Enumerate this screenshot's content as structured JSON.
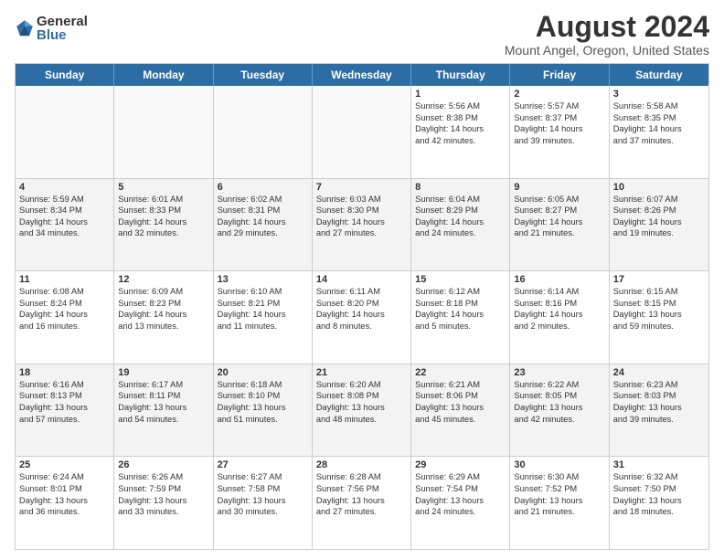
{
  "logo": {
    "general": "General",
    "blue": "Blue"
  },
  "title": "August 2024",
  "subtitle": "Mount Angel, Oregon, United States",
  "days": [
    "Sunday",
    "Monday",
    "Tuesday",
    "Wednesday",
    "Thursday",
    "Friday",
    "Saturday"
  ],
  "weeks": [
    [
      {
        "day": "",
        "lines": [],
        "empty": true
      },
      {
        "day": "",
        "lines": [],
        "empty": true
      },
      {
        "day": "",
        "lines": [],
        "empty": true
      },
      {
        "day": "",
        "lines": [],
        "empty": true
      },
      {
        "day": "1",
        "lines": [
          "Sunrise: 5:56 AM",
          "Sunset: 8:38 PM",
          "Daylight: 14 hours",
          "and 42 minutes."
        ]
      },
      {
        "day": "2",
        "lines": [
          "Sunrise: 5:57 AM",
          "Sunset: 8:37 PM",
          "Daylight: 14 hours",
          "and 39 minutes."
        ]
      },
      {
        "day": "3",
        "lines": [
          "Sunrise: 5:58 AM",
          "Sunset: 8:35 PM",
          "Daylight: 14 hours",
          "and 37 minutes."
        ]
      }
    ],
    [
      {
        "day": "4",
        "lines": [
          "Sunrise: 5:59 AM",
          "Sunset: 8:34 PM",
          "Daylight: 14 hours",
          "and 34 minutes."
        ]
      },
      {
        "day": "5",
        "lines": [
          "Sunrise: 6:01 AM",
          "Sunset: 8:33 PM",
          "Daylight: 14 hours",
          "and 32 minutes."
        ]
      },
      {
        "day": "6",
        "lines": [
          "Sunrise: 6:02 AM",
          "Sunset: 8:31 PM",
          "Daylight: 14 hours",
          "and 29 minutes."
        ]
      },
      {
        "day": "7",
        "lines": [
          "Sunrise: 6:03 AM",
          "Sunset: 8:30 PM",
          "Daylight: 14 hours",
          "and 27 minutes."
        ]
      },
      {
        "day": "8",
        "lines": [
          "Sunrise: 6:04 AM",
          "Sunset: 8:29 PM",
          "Daylight: 14 hours",
          "and 24 minutes."
        ]
      },
      {
        "day": "9",
        "lines": [
          "Sunrise: 6:05 AM",
          "Sunset: 8:27 PM",
          "Daylight: 14 hours",
          "and 21 minutes."
        ]
      },
      {
        "day": "10",
        "lines": [
          "Sunrise: 6:07 AM",
          "Sunset: 8:26 PM",
          "Daylight: 14 hours",
          "and 19 minutes."
        ]
      }
    ],
    [
      {
        "day": "11",
        "lines": [
          "Sunrise: 6:08 AM",
          "Sunset: 8:24 PM",
          "Daylight: 14 hours",
          "and 16 minutes."
        ]
      },
      {
        "day": "12",
        "lines": [
          "Sunrise: 6:09 AM",
          "Sunset: 8:23 PM",
          "Daylight: 14 hours",
          "and 13 minutes."
        ]
      },
      {
        "day": "13",
        "lines": [
          "Sunrise: 6:10 AM",
          "Sunset: 8:21 PM",
          "Daylight: 14 hours",
          "and 11 minutes."
        ]
      },
      {
        "day": "14",
        "lines": [
          "Sunrise: 6:11 AM",
          "Sunset: 8:20 PM",
          "Daylight: 14 hours",
          "and 8 minutes."
        ]
      },
      {
        "day": "15",
        "lines": [
          "Sunrise: 6:12 AM",
          "Sunset: 8:18 PM",
          "Daylight: 14 hours",
          "and 5 minutes."
        ]
      },
      {
        "day": "16",
        "lines": [
          "Sunrise: 6:14 AM",
          "Sunset: 8:16 PM",
          "Daylight: 14 hours",
          "and 2 minutes."
        ]
      },
      {
        "day": "17",
        "lines": [
          "Sunrise: 6:15 AM",
          "Sunset: 8:15 PM",
          "Daylight: 13 hours",
          "and 59 minutes."
        ]
      }
    ],
    [
      {
        "day": "18",
        "lines": [
          "Sunrise: 6:16 AM",
          "Sunset: 8:13 PM",
          "Daylight: 13 hours",
          "and 57 minutes."
        ]
      },
      {
        "day": "19",
        "lines": [
          "Sunrise: 6:17 AM",
          "Sunset: 8:11 PM",
          "Daylight: 13 hours",
          "and 54 minutes."
        ]
      },
      {
        "day": "20",
        "lines": [
          "Sunrise: 6:18 AM",
          "Sunset: 8:10 PM",
          "Daylight: 13 hours",
          "and 51 minutes."
        ]
      },
      {
        "day": "21",
        "lines": [
          "Sunrise: 6:20 AM",
          "Sunset: 8:08 PM",
          "Daylight: 13 hours",
          "and 48 minutes."
        ]
      },
      {
        "day": "22",
        "lines": [
          "Sunrise: 6:21 AM",
          "Sunset: 8:06 PM",
          "Daylight: 13 hours",
          "and 45 minutes."
        ]
      },
      {
        "day": "23",
        "lines": [
          "Sunrise: 6:22 AM",
          "Sunset: 8:05 PM",
          "Daylight: 13 hours",
          "and 42 minutes."
        ]
      },
      {
        "day": "24",
        "lines": [
          "Sunrise: 6:23 AM",
          "Sunset: 8:03 PM",
          "Daylight: 13 hours",
          "and 39 minutes."
        ]
      }
    ],
    [
      {
        "day": "25",
        "lines": [
          "Sunrise: 6:24 AM",
          "Sunset: 8:01 PM",
          "Daylight: 13 hours",
          "and 36 minutes."
        ]
      },
      {
        "day": "26",
        "lines": [
          "Sunrise: 6:26 AM",
          "Sunset: 7:59 PM",
          "Daylight: 13 hours",
          "and 33 minutes."
        ]
      },
      {
        "day": "27",
        "lines": [
          "Sunrise: 6:27 AM",
          "Sunset: 7:58 PM",
          "Daylight: 13 hours",
          "and 30 minutes."
        ]
      },
      {
        "day": "28",
        "lines": [
          "Sunrise: 6:28 AM",
          "Sunset: 7:56 PM",
          "Daylight: 13 hours",
          "and 27 minutes."
        ]
      },
      {
        "day": "29",
        "lines": [
          "Sunrise: 6:29 AM",
          "Sunset: 7:54 PM",
          "Daylight: 13 hours",
          "and 24 minutes."
        ]
      },
      {
        "day": "30",
        "lines": [
          "Sunrise: 6:30 AM",
          "Sunset: 7:52 PM",
          "Daylight: 13 hours",
          "and 21 minutes."
        ]
      },
      {
        "day": "31",
        "lines": [
          "Sunrise: 6:32 AM",
          "Sunset: 7:50 PM",
          "Daylight: 13 hours",
          "and 18 minutes."
        ]
      }
    ]
  ]
}
